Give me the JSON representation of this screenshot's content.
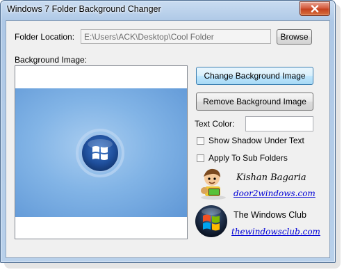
{
  "window": {
    "title": "Windows 7 Folder Background Changer"
  },
  "folder": {
    "label": "Folder Location:",
    "value": "E:\\Users\\ACK\\Desktop\\Cool Folder",
    "browse_label": "Browse"
  },
  "background": {
    "label": "Background Image:",
    "change_label": "Change Background Image",
    "remove_label": "Remove Background Image"
  },
  "text_color": {
    "label": "Text Color:"
  },
  "options": {
    "shadow_label": "Show Shadow Under Text",
    "shadow_checked": false,
    "subfolders_label": "Apply To Sub Folders",
    "subfolders_checked": false
  },
  "credits": {
    "author_name": "Kishan Bagaria",
    "author_link": "door2windows.com",
    "club_name": "The Windows Club",
    "club_link": "thewindowsclub.com"
  },
  "icons": [
    "close-icon",
    "windows-logo-icon",
    "author-avatar-icon",
    "windows-club-logo-icon"
  ],
  "colors": {
    "titlebar": "#b8d0ea",
    "close_button": "#c3401f",
    "client_bg": "#f0f0f0",
    "link": "#0000d6",
    "focused_button": "#bee6fd"
  }
}
